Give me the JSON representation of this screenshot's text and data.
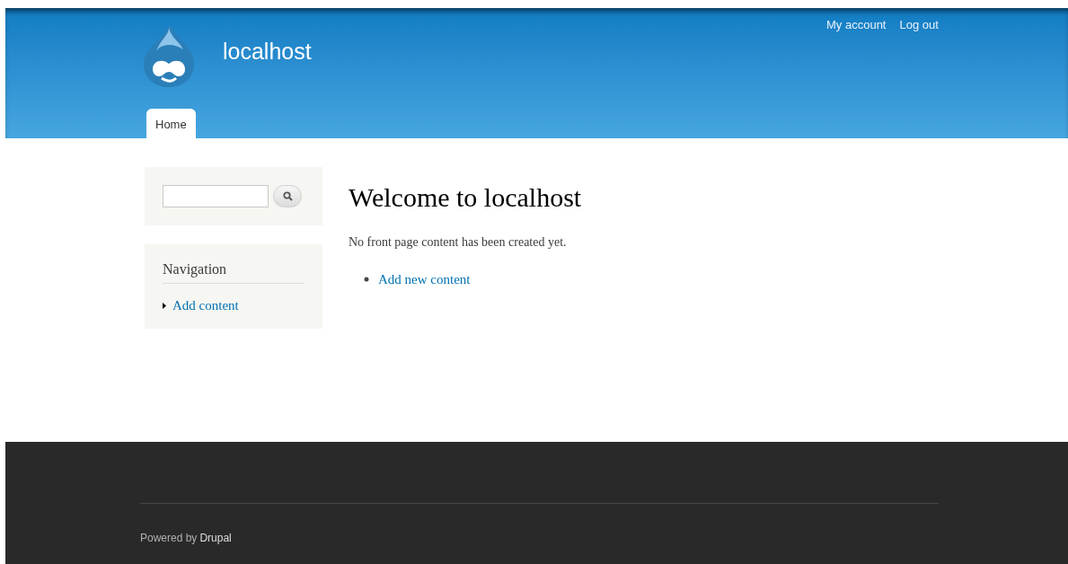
{
  "site_name": "localhost",
  "user_menu": [
    "My account",
    "Log out"
  ],
  "tabs": [
    {
      "label": "Home",
      "selected": true
    }
  ],
  "navigation": {
    "title": "Navigation",
    "items": [
      "Add content"
    ]
  },
  "main": {
    "title": "Welcome to localhost",
    "message": "No front page content has been created yet.",
    "links": [
      "Add new content"
    ]
  },
  "footer": {
    "text": "Powered by",
    "link": "Drupal"
  }
}
